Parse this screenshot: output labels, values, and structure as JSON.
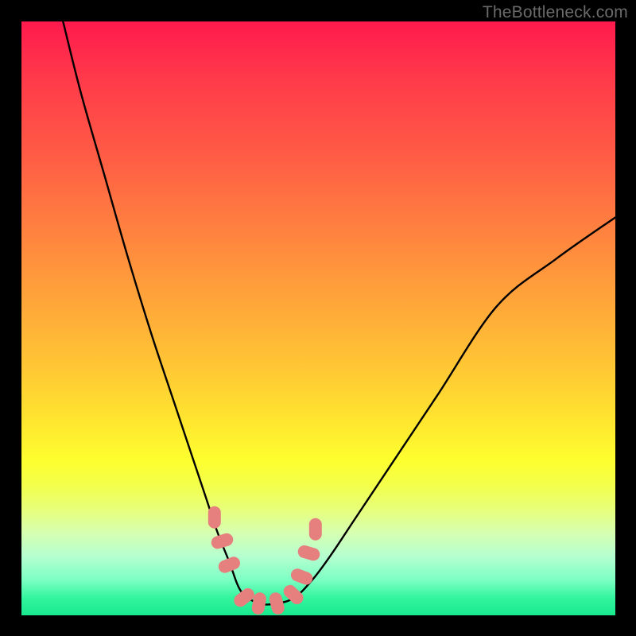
{
  "watermark": "TheBottleneck.com",
  "colors": {
    "frame": "#000000",
    "curve_stroke": "#000000",
    "marker_fill": "#e6807e",
    "gradient_top": "#ff1a4d",
    "gradient_bottom": "#18e98f"
  },
  "chart_data": {
    "type": "line",
    "title": "",
    "xlabel": "",
    "ylabel": "",
    "xlim": [
      0,
      100
    ],
    "ylim": [
      0,
      100
    ],
    "note": "x and y are normalized 0–100 across the plot area; high y = top (red), low y = bottom (green). Curve is a V/U shape with minimum plateau near x≈37–46 at y≈2.",
    "series": [
      {
        "name": "bottleneck-curve",
        "x": [
          7,
          10,
          14,
          18,
          22,
          26,
          29,
          31,
          33,
          35,
          37,
          40,
          43,
          46,
          49,
          52,
          56,
          62,
          70,
          80,
          90,
          100
        ],
        "y": [
          100,
          88,
          74,
          60,
          47,
          35,
          26,
          20,
          14,
          9,
          4,
          2,
          2,
          3,
          6,
          10,
          16,
          25,
          37,
          52,
          60,
          67
        ]
      }
    ],
    "markers": {
      "name": "highlighted-points",
      "x": [
        32.5,
        33.8,
        35.0,
        37.5,
        40.0,
        43.0,
        45.8,
        47.2,
        48.4,
        49.5
      ],
      "y": [
        16.5,
        12.5,
        8.5,
        3.0,
        2.0,
        2.0,
        3.5,
        6.5,
        10.5,
        14.5
      ]
    }
  }
}
